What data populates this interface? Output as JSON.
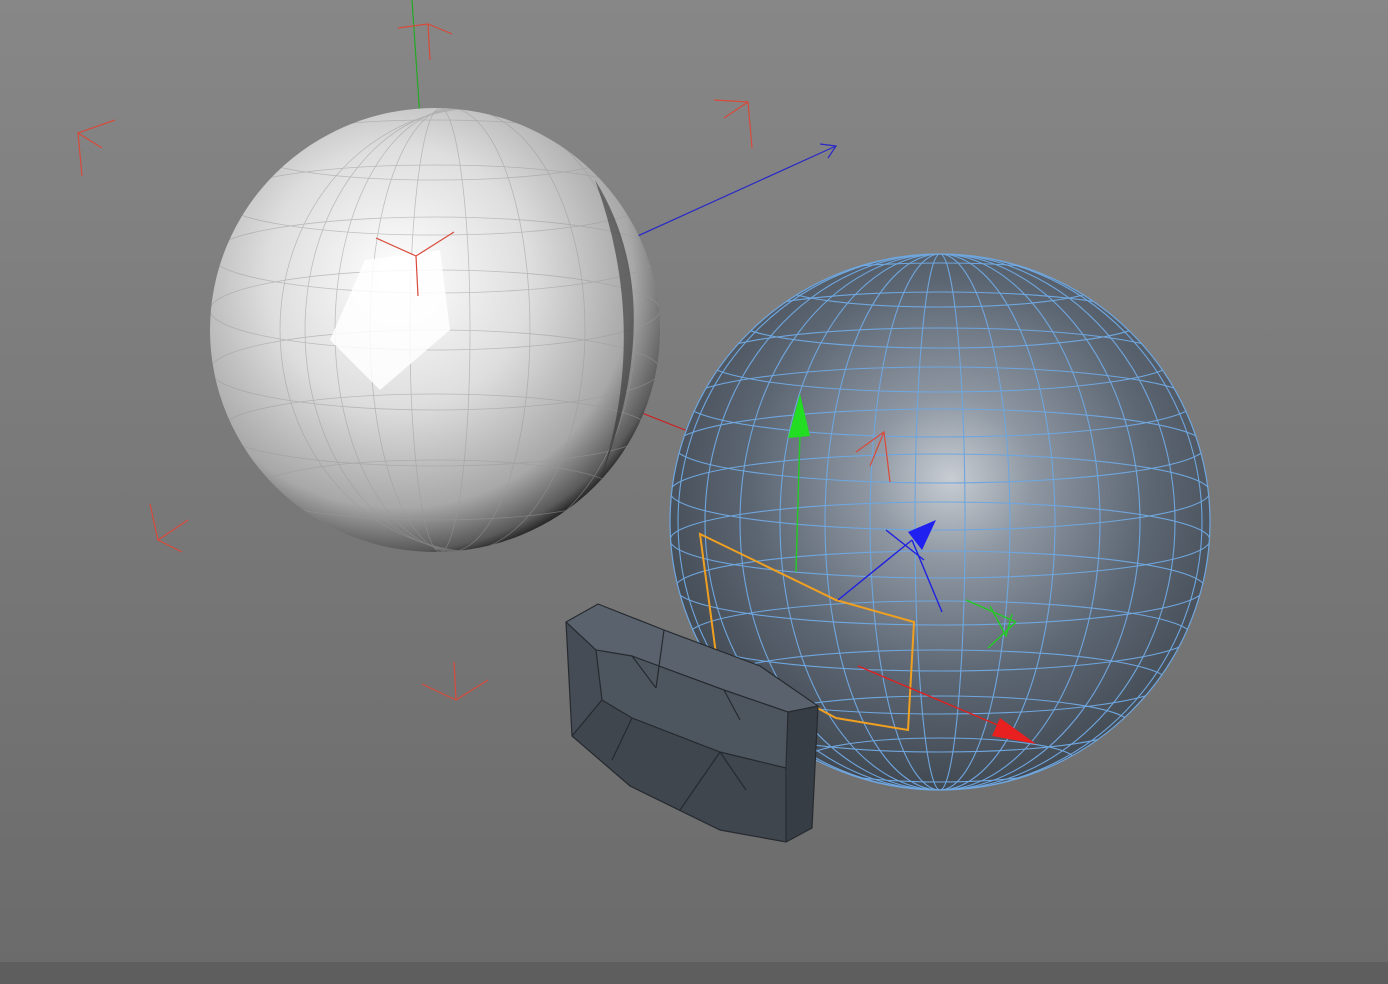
{
  "viewport": {
    "background_top": "#868686",
    "background_bottom": "#6c6c6c",
    "status_strip_color": "#5e5e5e"
  },
  "colors": {
    "axis_x": "#e02020",
    "axis_y": "#22cc22",
    "axis_z": "#2020e0",
    "bbox_corner": "#d84a3a",
    "wireframe": "#6fa6de",
    "selected_polygons": "#f0a020",
    "white_sphere_fill": "#d6d6d6",
    "blue_sphere_fill": "#5e6874",
    "extruded_fill": "#4e5761"
  },
  "objects": [
    {
      "name": "white-sphere",
      "display": "gouraud-flat",
      "selected": false
    },
    {
      "name": "selected-sphere",
      "display": "shaded-wire",
      "selected": true
    },
    {
      "name": "extruded-polygon-piece",
      "display": "shaded",
      "selected": false
    }
  ],
  "icons": [
    "move-gizmo-icon",
    "axis-x-arrow-icon",
    "axis-y-arrow-icon",
    "axis-z-arrow-icon",
    "world-axis-icon"
  ]
}
